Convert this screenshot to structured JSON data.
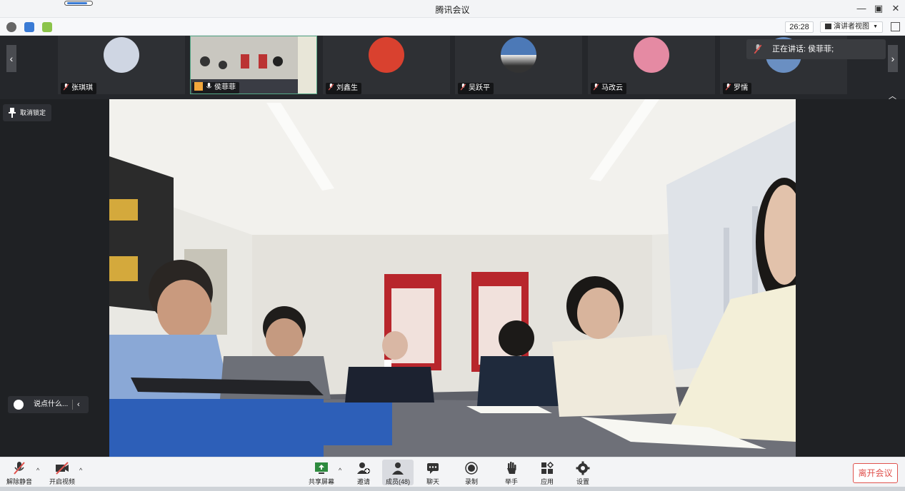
{
  "window": {
    "title": "腾讯会议"
  },
  "status": {
    "timer": "26:28",
    "view_label": "演讲者视图"
  },
  "participants": [
    {
      "name": "张琪琪",
      "avatar_color": "#cfd6e3"
    },
    {
      "name": "侯菲菲",
      "avatar_color": "#7d8a90"
    },
    {
      "name": "刘鑫生",
      "avatar_color": "#d9412f"
    },
    {
      "name": "吴跃平",
      "avatar_color": "#4c79b7"
    },
    {
      "name": "马改云",
      "avatar_color": "#e58aa3"
    },
    {
      "name": "罗懦",
      "avatar_color": "#6a8fc2"
    }
  ],
  "speaking_now": "正在讲话: 侯菲菲;",
  "unlock_label": "取消锁定",
  "chat": {
    "placeholder": "说点什么..."
  },
  "toolbar": {
    "mute": "解除静音",
    "video": "开启视频",
    "share": "共享屏幕",
    "invite": "邀请",
    "members": "成员(48)",
    "chat": "聊天",
    "record": "录制",
    "raise_hand": "举手",
    "apps": "应用",
    "settings": "设置",
    "leave": "离开会议"
  },
  "colors": {
    "accent": "#3a7bd5",
    "leave": "#e0524d",
    "mic_muted": "#e0524d"
  }
}
